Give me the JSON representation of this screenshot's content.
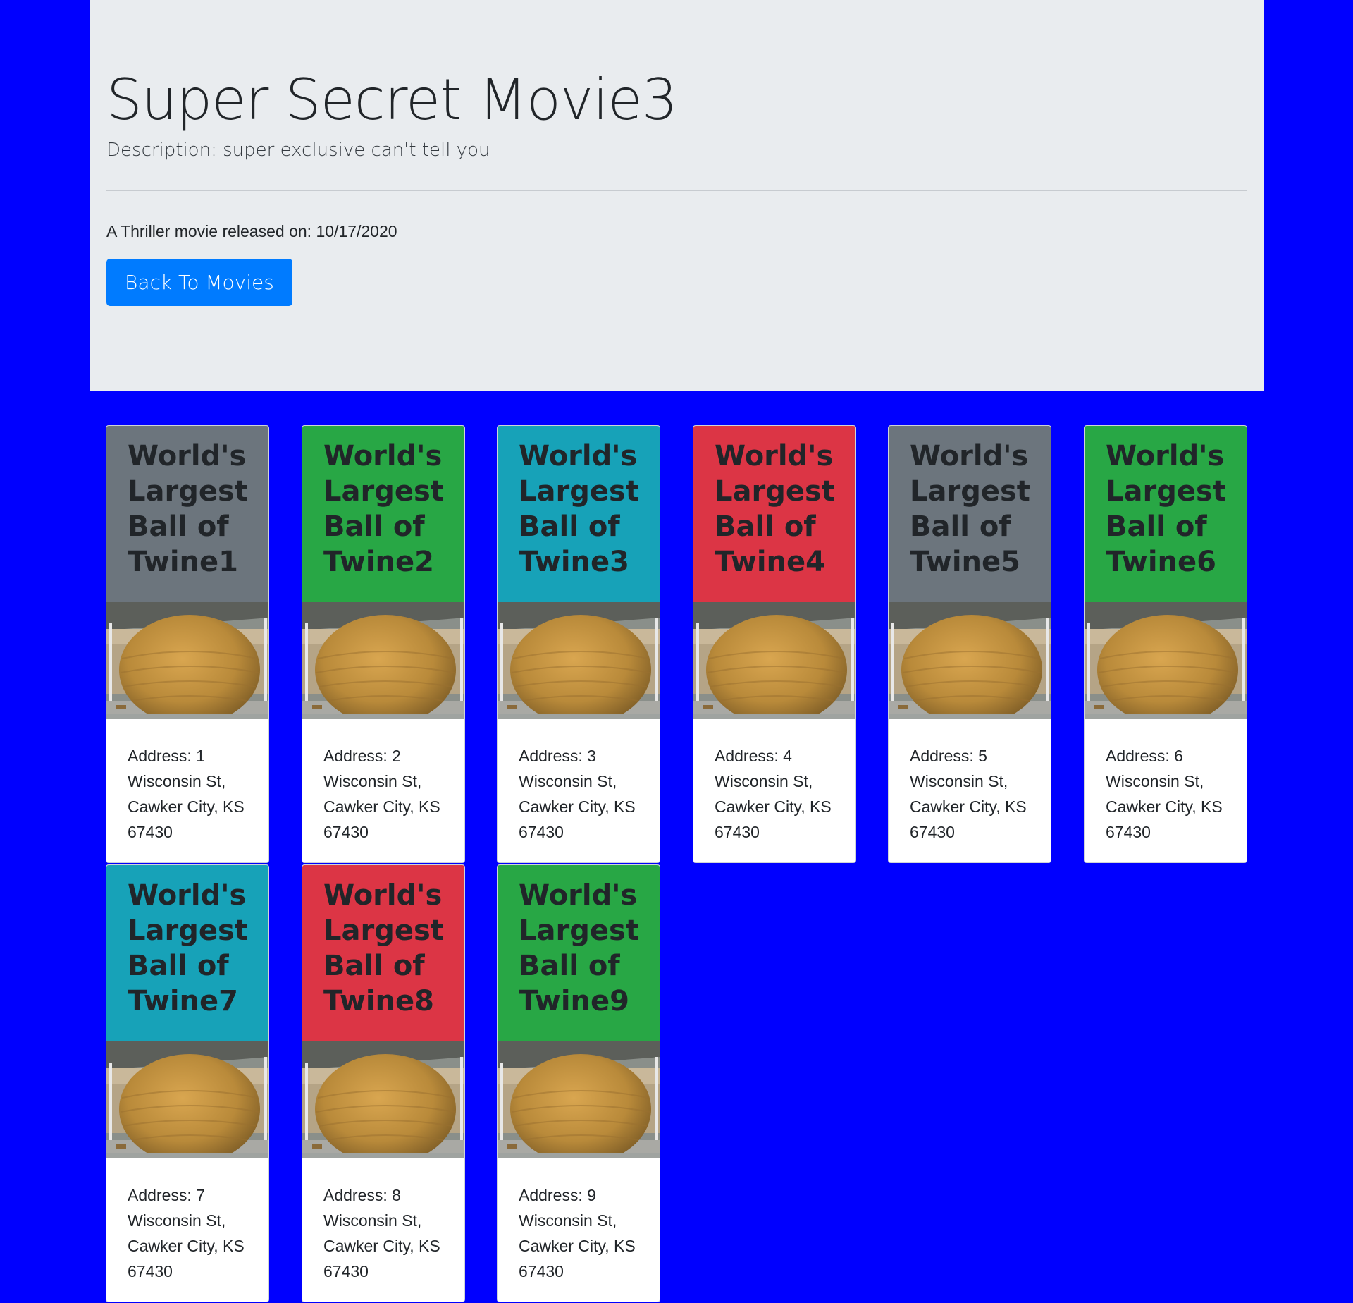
{
  "header": {
    "title": "Super Secret Movie3",
    "description": "Description: super exclusive can't tell you",
    "meta": "A Thriller movie released on: 10/17/2020",
    "back_label": "Back To Movies"
  },
  "cards": [
    {
      "title": "World's Largest Ball of Twine1",
      "address": "Address: 1 Wisconsin St, Cawker City, KS 67430",
      "color": "#6c757d"
    },
    {
      "title": "World's Largest Ball of Twine2",
      "address": "Address: 2 Wisconsin St, Cawker City, KS 67430",
      "color": "#28a745"
    },
    {
      "title": "World's Largest Ball of Twine3",
      "address": "Address: 3 Wisconsin St, Cawker City, KS 67430",
      "color": "#17a2b8"
    },
    {
      "title": "World's Largest Ball of Twine4",
      "address": "Address: 4 Wisconsin St, Cawker City, KS 67430",
      "color": "#dc3545"
    },
    {
      "title": "World's Largest Ball of Twine5",
      "address": "Address: 5 Wisconsin St, Cawker City, KS 67430",
      "color": "#6c757d"
    },
    {
      "title": "World's Largest Ball of Twine6",
      "address": "Address: 6 Wisconsin St, Cawker City, KS 67430",
      "color": "#28a745"
    },
    {
      "title": "World's Largest Ball of Twine7",
      "address": "Address: 7 Wisconsin St, Cawker City, KS 67430",
      "color": "#17a2b8"
    },
    {
      "title": "World's Largest Ball of Twine8",
      "address": "Address: 8 Wisconsin St, Cawker City, KS 67430",
      "color": "#dc3545"
    },
    {
      "title": "World's Largest Ball of Twine9",
      "address": "Address: 9 Wisconsin St, Cawker City, KS 67430",
      "color": "#28a745"
    }
  ]
}
